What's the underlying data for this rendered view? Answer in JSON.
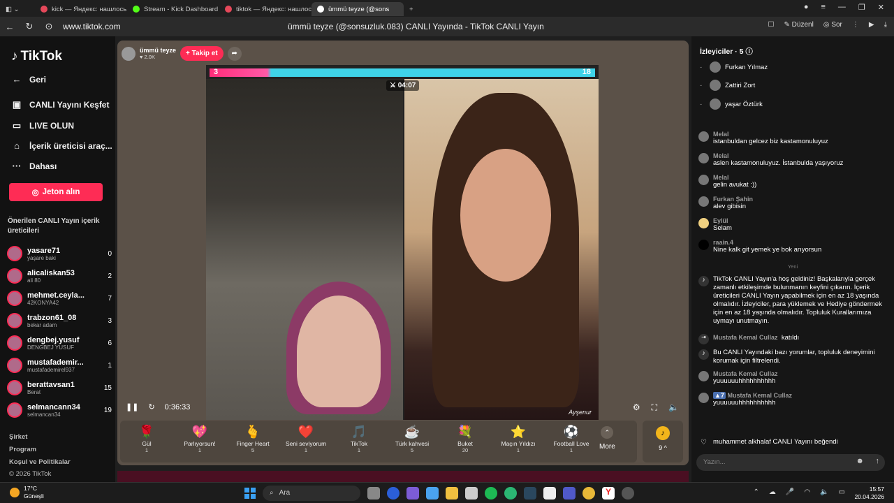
{
  "browser": {
    "tabs": [
      {
        "label": "kick — Яндекс: нашлось 1",
        "color": "#e5485a"
      },
      {
        "label": "Stream - Kick Dashboard",
        "color": "#53fc18"
      },
      {
        "label": "tiktok — Яндекс: нашлось",
        "color": "#e5485a"
      },
      {
        "label": "ümmü teyze (@sons",
        "color": "#ffffff"
      }
    ],
    "url": "www.tiktok.com",
    "page_title": "ümmü teyze (@sonsuzluk.083) CANLI Yayında - TikTok CANLI Yayın",
    "right_items": [
      "Düzenl",
      "Sor"
    ]
  },
  "sidebar": {
    "logo": "TikTok",
    "menu": [
      {
        "label": "Geri",
        "icon": "arrow-left-icon"
      },
      {
        "label": "CANLI Yayını Keşfet",
        "icon": "live-explore-icon"
      },
      {
        "label": "LIVE OLUN",
        "icon": "camera-icon"
      },
      {
        "label": "İçerik üreticisi araç...",
        "icon": "home-icon"
      },
      {
        "label": "Dahası",
        "icon": "more-icon"
      }
    ],
    "coin_button": "Jeton alın",
    "recommended_title": "Önerilen CANLI Yayın içerik üreticileri",
    "creators": [
      {
        "name": "yasare71",
        "sub": "yaşare baki",
        "count": "0"
      },
      {
        "name": "alicaliskan53",
        "sub": "ali 80",
        "count": "2"
      },
      {
        "name": "mehmet.ceyla...",
        "sub": "42KONYA42",
        "count": "7"
      },
      {
        "name": "trabzon61_08",
        "sub": "bekar adam",
        "count": "3"
      },
      {
        "name": "dengbej.yusuf",
        "sub": "DENGBEJ YUSUF",
        "count": "6"
      },
      {
        "name": "mustafademir...",
        "sub": "mustafademirel937",
        "count": "1"
      },
      {
        "name": "berattavsan1",
        "sub": "Berat",
        "count": "15"
      },
      {
        "name": "selmancann34",
        "sub": "selmancan34",
        "count": "19"
      }
    ],
    "footer": [
      "Şirket",
      "Program",
      "Koşul ve Politikalar",
      "© 2026 TikTok"
    ]
  },
  "stream": {
    "host_name": "ümmü teyze",
    "host_likes": "2.0K",
    "follow_label": "+ Takip et",
    "score_left": "3",
    "score_right": "18",
    "timer": "04:07",
    "watermark": "Ayşenur",
    "elapsed": "0:36:33",
    "gifts": [
      {
        "name": "Gül",
        "price": "1",
        "icon": "🌹"
      },
      {
        "name": "Parlıyorsun!",
        "price": "1",
        "icon": "💖"
      },
      {
        "name": "Finger Heart",
        "price": "5",
        "icon": "🫰"
      },
      {
        "name": "Seni seviyorum",
        "price": "1",
        "icon": "❤️"
      },
      {
        "name": "TikTok",
        "price": "1",
        "icon": "🎵"
      },
      {
        "name": "Türk kahvesi",
        "price": "5",
        "icon": "☕"
      },
      {
        "name": "Buket",
        "price": "20",
        "icon": "💐"
      },
      {
        "name": "Maçın Yıldızı",
        "price": "1",
        "icon": "⭐"
      },
      {
        "name": "Football Love",
        "price": "1",
        "icon": "⚽"
      }
    ],
    "more_label": "More",
    "coins_label": "9 ^"
  },
  "chat": {
    "viewers_title": "İzleyiciler",
    "viewers_count": "5",
    "viewers": [
      {
        "rank": "-",
        "name": "Furkan Yılmaz"
      },
      {
        "rank": "-",
        "name": "Zattiri Zort"
      },
      {
        "rank": "-",
        "name": "yaşar Öztürk"
      }
    ],
    "messages": [
      {
        "user": "Melal",
        "text": "istanbuldan gelcez biz kastamonuluyuz"
      },
      {
        "user": "Melal",
        "text": "aslen kastamonuluyuz. İstanbulda yaşıyoruz"
      },
      {
        "user": "Melal",
        "text": "gelin avukat :))"
      },
      {
        "user": "Furkan Şahin",
        "text": "alev gibisin"
      },
      {
        "user": "Eylül",
        "text": "Selam"
      },
      {
        "user": "raain.4",
        "text": "Nine kalk git yemek ye bok arıyorsun"
      }
    ],
    "new_label": "Yeni",
    "system_msg": "TikTok CANLI Yayın'a hoş geldiniz! Başkalarıyla gerçek zamanlı etkileşimde bulunmanın keyfini çıkarın. İçerik üreticileri CANLI Yayın yapabilmek için en az 18 yaşında olmalıdır. İzleyiciler, para yüklemek ve Hediye göndermek için en az 18 yaşında olmalıdır. Topluluk Kurallarımıza uymayı unutmayın.",
    "joined_user": "Mustafa Kemal Cullaz",
    "joined_text": "katıldı",
    "filter_msg": "Bu CANLI Yayındaki bazı yorumlar, topluluk deneyimini korumak için filtrelendi.",
    "late_messages": [
      {
        "user": "Mustafa Kemal Cullaz",
        "text": "yuuuuuuhhhhhhhhhh"
      },
      {
        "user": "Mustafa Kemal Cullaz",
        "text": "yuuuuuuhhhhhhhhhh",
        "badge": "7"
      }
    ],
    "like_user": "muhammet alkhalaf",
    "like_text": "CANLI Yayını beğendi",
    "input_placeholder": "Yazın..."
  },
  "taskbar": {
    "temp": "17°C",
    "weather": "Güneşli",
    "search": "Ara",
    "time": "15:57",
    "date": "20.04.2026"
  }
}
